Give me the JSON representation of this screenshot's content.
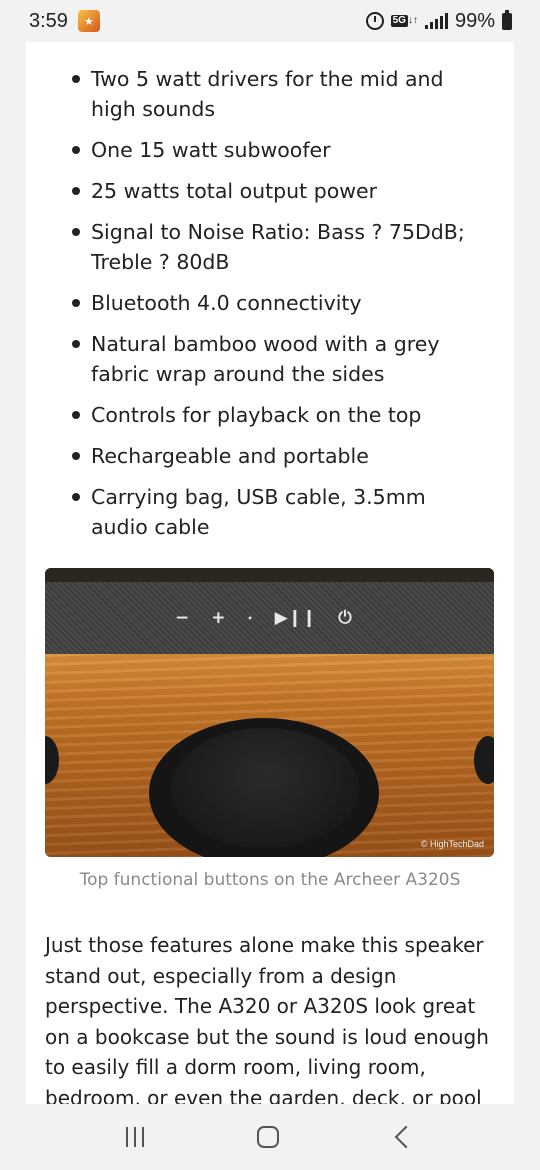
{
  "status_bar": {
    "time": "3:59",
    "network_badge": "5G",
    "battery": "99%"
  },
  "features": [
    "Two 5 watt drivers for the mid and high sounds",
    "One 15 watt subwoofer",
    "25 watts total output power",
    "Signal to Noise Ratio: Bass ? 75DdB; Treble ? 80dB",
    "Bluetooth 4.0 connectivity",
    "Natural bamboo wood with a grey fabric wrap around the sides",
    "Controls for playback on the top",
    "Rechargeable and portable",
    "Carrying bag, USB cable, 3.5mm audio cable"
  ],
  "figure": {
    "watermark": "© HighTechDad",
    "caption": "Top functional buttons on the Archeer A320S"
  },
  "paragraph": "Just those features alone make this speaker stand out, especially from a design perspective. The A320 or A320S look great on a bookcase but the sound is loud enough to easily fill a dorm room, living room, bedroom, or even the garden, deck, or pool"
}
